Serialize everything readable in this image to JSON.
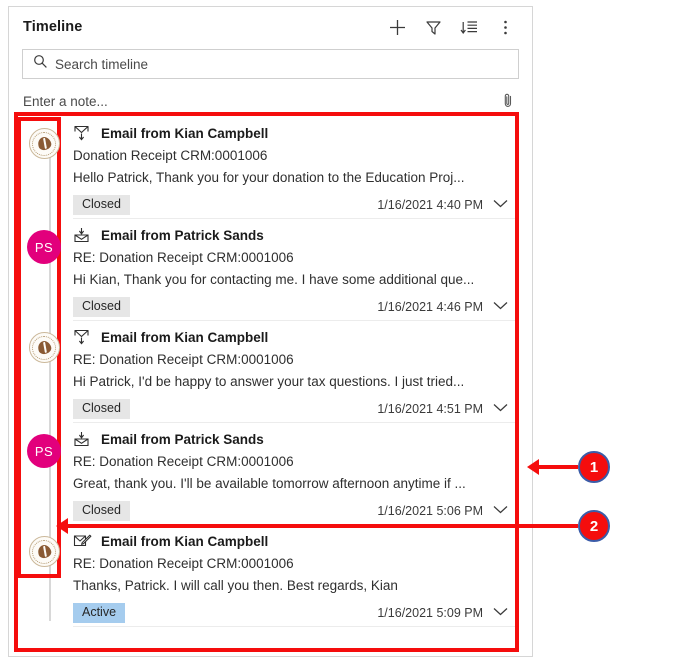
{
  "panel": {
    "title": "Timeline",
    "header_actions": [
      {
        "name": "add",
        "icon": "plus-icon",
        "label": "Add"
      },
      {
        "name": "filter",
        "icon": "filter-icon",
        "label": "Filter"
      },
      {
        "name": "sort",
        "icon": "sort-descending-icon",
        "label": "Sort"
      },
      {
        "name": "more",
        "icon": "more-vertical-icon",
        "label": "More commands"
      }
    ],
    "search": {
      "placeholder": "Search timeline",
      "value": "",
      "icon": "search-icon"
    },
    "note": {
      "placeholder": "Enter a note...",
      "value": "",
      "attach_icon": "paperclip-icon"
    }
  },
  "timeline": {
    "entries": [
      {
        "avatar": {
          "type": "logo",
          "initials": ""
        },
        "icon": "email-sent-icon",
        "title": "Email from Kian Campbell",
        "subject": "Donation Receipt CRM:0001006",
        "preview": "Hello Patrick,   Thank you for your donation to the Education Proj...",
        "status": "Closed",
        "status_style": "closed",
        "date": "1/16/2021 4:40 PM",
        "chevron": "chevron-down-icon"
      },
      {
        "avatar": {
          "type": "initials",
          "initials": "PS"
        },
        "icon": "email-received-icon",
        "title": "Email from Patrick Sands",
        "subject": "RE: Donation Receipt CRM:0001006",
        "preview": "Hi Kian, Thank you for contacting me. I have some additional que...",
        "status": "Closed",
        "status_style": "closed",
        "date": "1/16/2021 4:46 PM",
        "chevron": "chevron-down-icon"
      },
      {
        "avatar": {
          "type": "logo",
          "initials": ""
        },
        "icon": "email-sent-icon",
        "title": "Email from Kian Campbell",
        "subject": "RE: Donation Receipt CRM:0001006",
        "preview": "Hi Patrick,   I'd be happy to answer your tax questions. I just tried...",
        "status": "Closed",
        "status_style": "closed",
        "date": "1/16/2021 4:51 PM",
        "chevron": "chevron-down-icon"
      },
      {
        "avatar": {
          "type": "initials",
          "initials": "PS"
        },
        "icon": "email-received-icon",
        "title": "Email from Patrick Sands",
        "subject": "RE: Donation Receipt CRM:0001006",
        "preview": "Great, thank you. I'll be available tomorrow afternoon anytime if ...",
        "status": "Closed",
        "status_style": "closed",
        "date": "1/16/2021 5:06 PM",
        "chevron": "chevron-down-icon"
      },
      {
        "avatar": {
          "type": "logo",
          "initials": ""
        },
        "icon": "email-draft-icon",
        "title": "Email from Kian Campbell",
        "subject": "RE: Donation Receipt CRM:0001006",
        "preview": "Thanks, Patrick. I will call you then.   Best regards, Kian",
        "status": "Active",
        "status_style": "active",
        "date": "1/16/2021 5:09 PM",
        "chevron": "chevron-down-icon"
      }
    ]
  },
  "annotations": {
    "markers": [
      {
        "number": "1",
        "target": "timeline-list-region"
      },
      {
        "number": "2",
        "target": "timeline-avatar-column"
      }
    ]
  },
  "colors": {
    "annotation_red": "#f50d0d",
    "marker_border": "#3b5ca8",
    "avatar_initials_bg": "#e2007c",
    "badge_closed_bg": "#e6e6e6",
    "badge_active_bg": "#a5ccee"
  }
}
